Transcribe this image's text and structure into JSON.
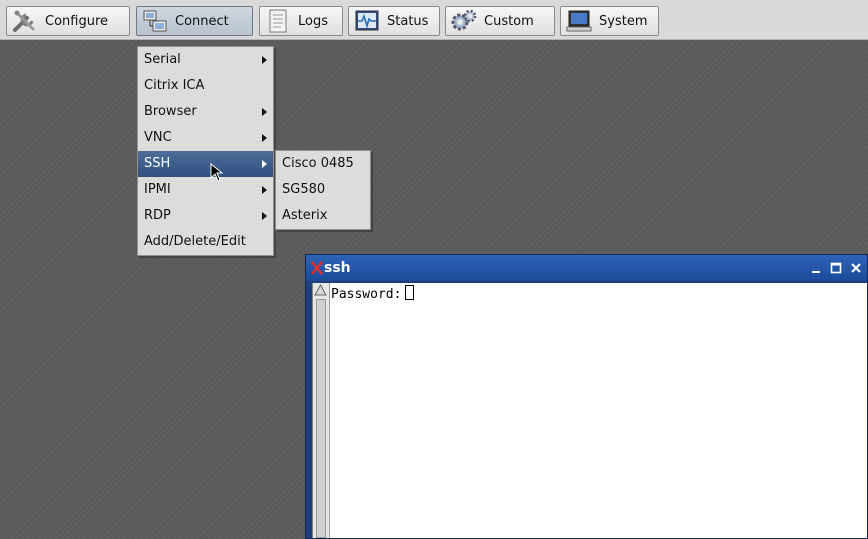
{
  "toolbar": {
    "buttons": [
      {
        "label": "Configure",
        "icon": "tools-icon"
      },
      {
        "label": "Connect",
        "icon": "network-icon"
      },
      {
        "label": "Logs",
        "icon": "document-icon"
      },
      {
        "label": "Status",
        "icon": "pulse-monitor-icon"
      },
      {
        "label": "Custom",
        "icon": "gears-icon"
      },
      {
        "label": "System",
        "icon": "computer-icon"
      }
    ]
  },
  "connect_menu": {
    "items": [
      {
        "label": "Serial",
        "has_submenu": true
      },
      {
        "label": "Citrix ICA",
        "has_submenu": false
      },
      {
        "label": "Browser",
        "has_submenu": true
      },
      {
        "label": "VNC",
        "has_submenu": true
      },
      {
        "label": "SSH",
        "has_submenu": true,
        "highlighted": true
      },
      {
        "label": "IPMI",
        "has_submenu": true
      },
      {
        "label": "RDP",
        "has_submenu": true
      },
      {
        "label": "Add/Delete/Edit",
        "has_submenu": false
      }
    ]
  },
  "ssh_submenu": {
    "items": [
      {
        "label": "Cisco 0485"
      },
      {
        "label": "SG580"
      },
      {
        "label": "Asterix"
      }
    ]
  },
  "terminal": {
    "title": "ssh",
    "prompt": "Password:"
  },
  "colors": {
    "desktop": "#5a5a5a",
    "menu_highlight": "#3b5b88",
    "titlebar": "#1b4a98",
    "toolbar": "#d9d9d9"
  }
}
